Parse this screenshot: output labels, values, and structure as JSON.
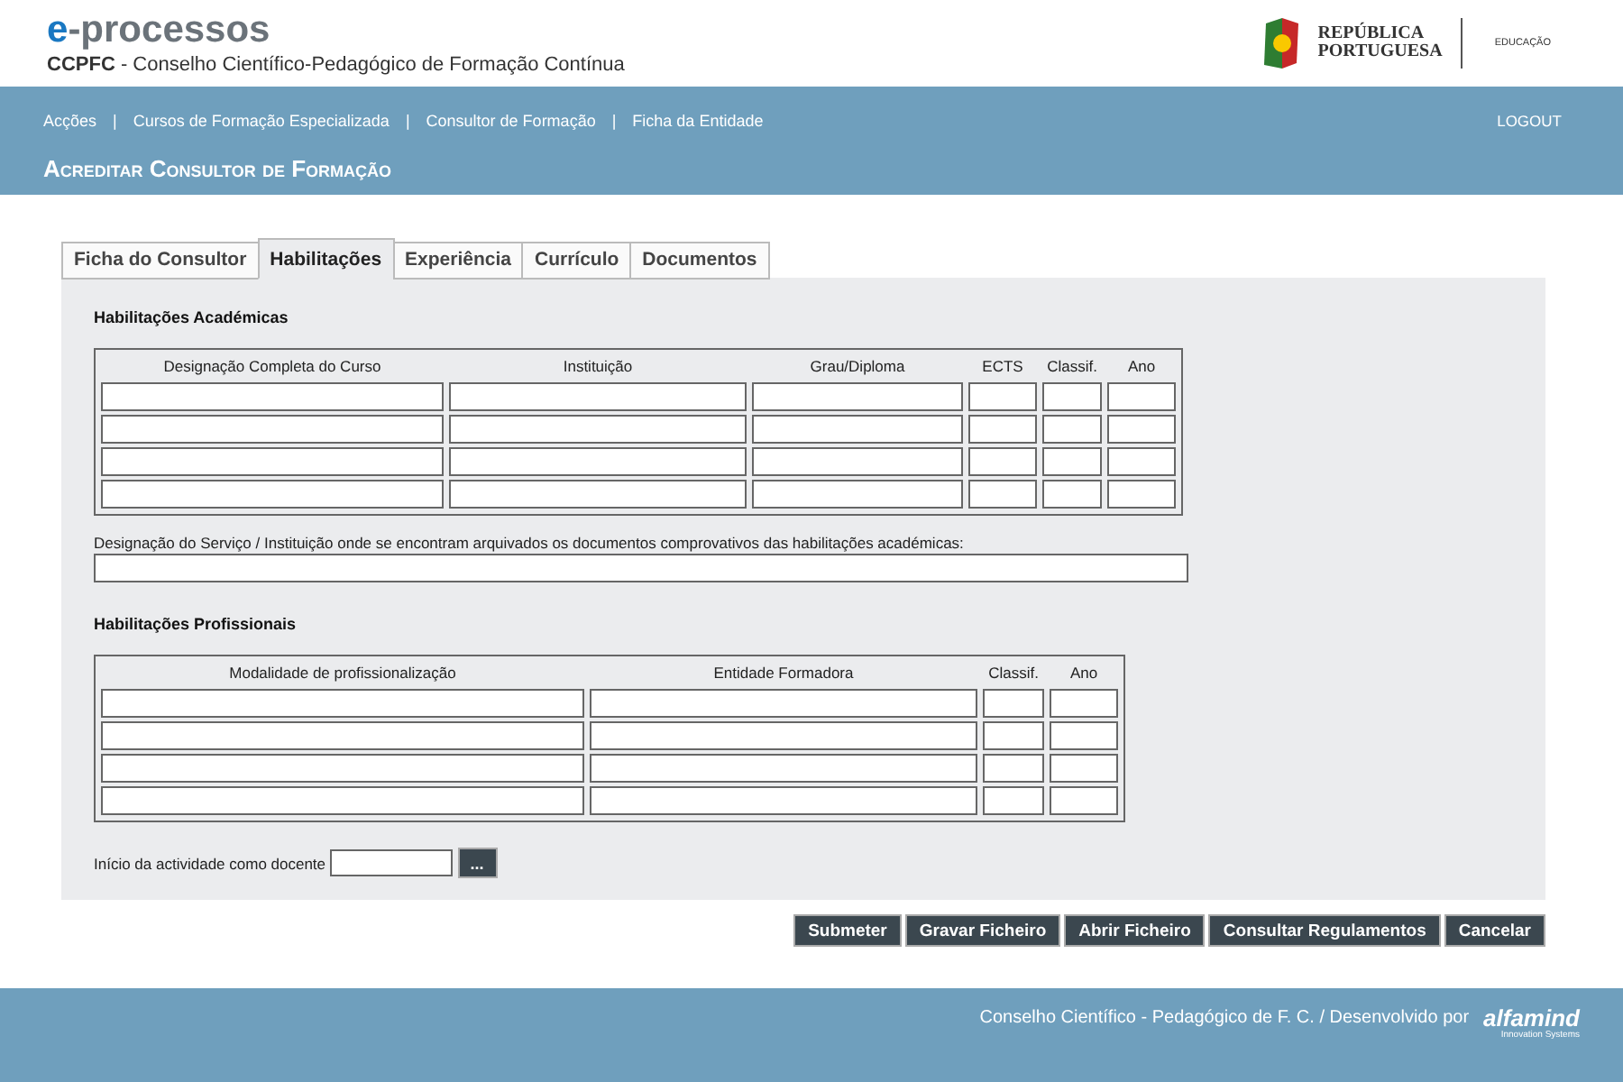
{
  "header": {
    "logo": "e-processos",
    "subtitle": "**CCPFC** - Conselho Científico-Pedagógico de Formação Contínua",
    "gov_logo": {
      "lines": [
        "REPÚBLICA",
        "PORTUGUESA"
      ],
      "ministry": "EDUCAÇÃO"
    }
  },
  "nav": {
    "items": [
      {
        "label": "Acções"
      },
      {
        "label": "Cursos de Formação Especializada"
      },
      {
        "label": "Consultor de Formação"
      },
      {
        "label": "Ficha da Entidade"
      }
    ],
    "separator": "|",
    "logout": "LOGOUT"
  },
  "page_title": "Acreditar Consultor de Formação",
  "tabs": [
    {
      "label": "Ficha do Consultor",
      "selected": false
    },
    {
      "label": "Habilitações",
      "selected": true
    },
    {
      "label": "Experiência",
      "selected": false
    },
    {
      "label": "Currículo",
      "selected": false
    },
    {
      "label": "Documentos",
      "selected": false
    }
  ],
  "academic": {
    "title": "Habilitações Académicas",
    "columns": [
      "Designação Completa do Curso",
      "Instituição",
      "Grau/Diploma",
      "ECTS",
      "Classif.",
      "Ano"
    ]
  },
  "archive_label": "Designação do Serviço / Instituição onde se encontram arquivados os documentos comprovativos das habilitações académicas:",
  "professional": {
    "title": "Habilitações Profissionais",
    "columns": [
      "Modalidade de profissionalização",
      "Entidade Formadora",
      "Classif.",
      "Ano"
    ]
  },
  "start_date": {
    "label": "Início da actividade como docente",
    "button": "..."
  },
  "buttons": [
    "Submeter",
    "Gravar Ficheiro",
    "Abrir Ficheiro",
    "Consultar Regulamentos",
    "Cancelar"
  ],
  "footer": {
    "text": "Conselho Científico - Pedagógico de F. C. /  Desenvolvido por",
    "brand": "alfamind",
    "tagline": "Innovation Systems"
  }
}
